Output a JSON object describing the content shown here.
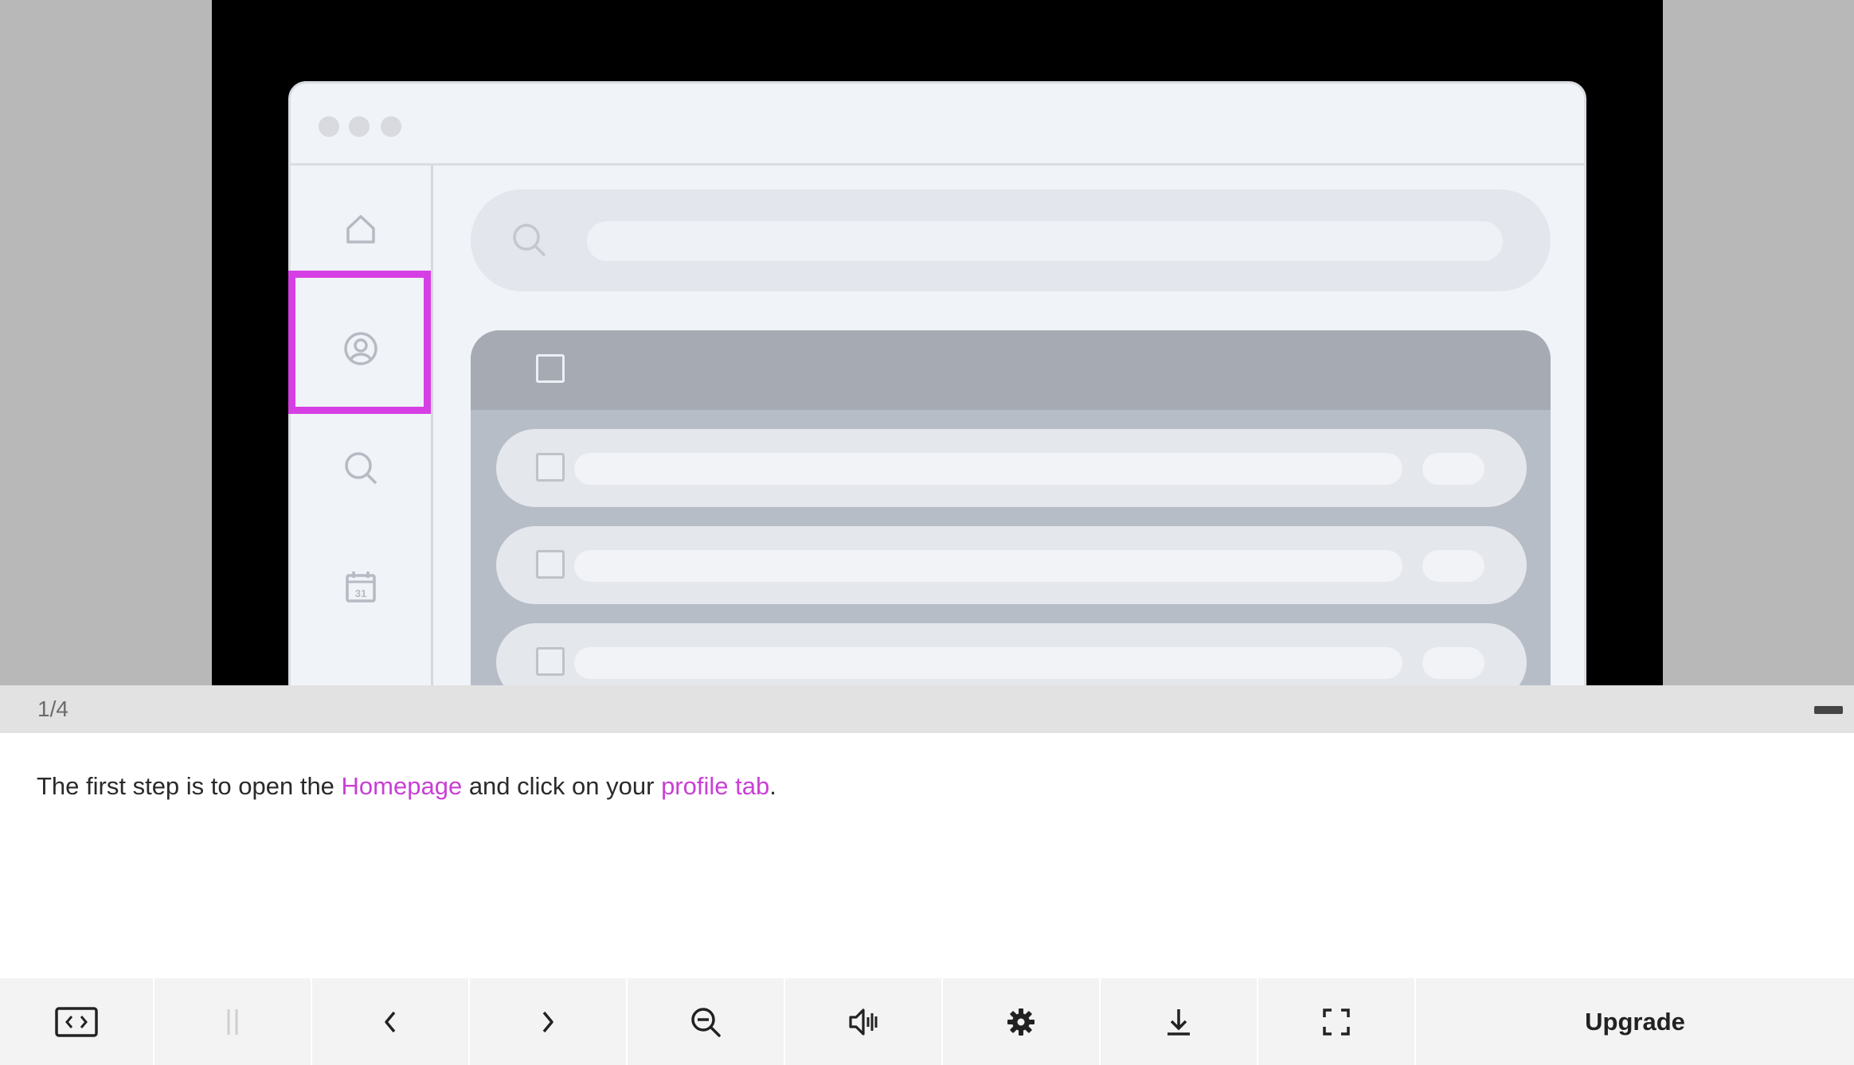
{
  "step": {
    "counter": "1/4"
  },
  "description": {
    "part1": "The first step is to open the ",
    "link1": "Homepage",
    "part2": " and click on your ",
    "link2": "profile tab",
    "part3": "."
  },
  "preview": {
    "sidebar_icons": [
      "home-icon",
      "profile-icon",
      "search-icon",
      "calendar-icon"
    ],
    "calendar_day": "31",
    "highlight_color": "#d63fe3"
  },
  "toolbar": {
    "buttons": [
      "embed-icon",
      "pause-icon",
      "chevron-left-icon",
      "chevron-right-icon",
      "zoom-out-icon",
      "volume-icon",
      "gear-icon",
      "download-icon",
      "fullscreen-icon"
    ],
    "upgrade_label": "Upgrade"
  },
  "colors": {
    "accent": "#c93fd6",
    "stage_bg": "#b8b8b8",
    "toolbar_bg": "#f3f3f3"
  }
}
